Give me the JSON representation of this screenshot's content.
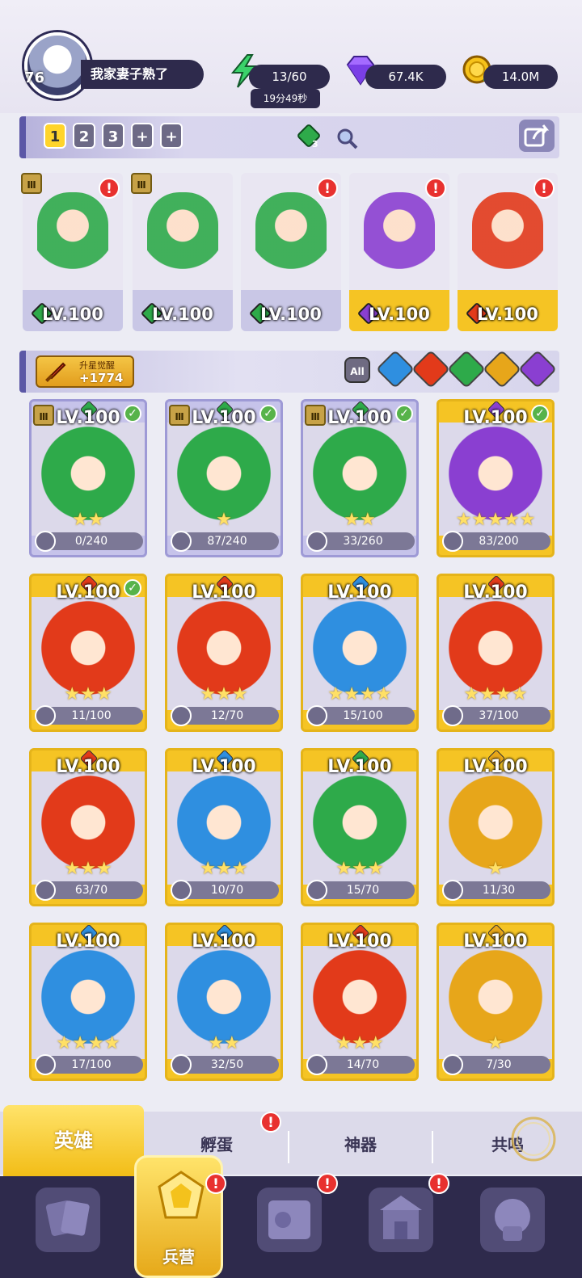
{
  "player": {
    "level": "76",
    "name": "我家妻子熟了"
  },
  "resources": {
    "energy": "13/60",
    "energy_timer": "19分49秒",
    "gems": "67.4K",
    "gold": "14.0M"
  },
  "team": {
    "tabs": [
      "1",
      "2",
      "3",
      "+",
      "+"
    ],
    "active_tab": "1",
    "badge_count": "3",
    "members": [
      {
        "level": "LV.100",
        "element": "nature",
        "color": "#c9c7e6",
        "alert": true,
        "rank": true
      },
      {
        "level": "LV.100",
        "element": "nature",
        "color": "#c9c7e6",
        "alert": false,
        "rank": true
      },
      {
        "level": "LV.100",
        "element": "nature",
        "color": "#c9c7e6",
        "alert": true,
        "rank": false
      },
      {
        "level": "LV.100",
        "element": "dark",
        "color": "#f5c424",
        "alert": true,
        "rank": false
      },
      {
        "level": "LV.100",
        "element": "fire",
        "color": "#f5c424",
        "alert": true,
        "rank": false
      }
    ]
  },
  "upgrade": {
    "label": "升星觉醒",
    "value": "+1774"
  },
  "filters": {
    "all_label": "All",
    "elements": [
      "water",
      "fire",
      "nature",
      "light",
      "dark"
    ]
  },
  "element_colors": {
    "water": "#2f8fe0",
    "fire": "#e23a1a",
    "nature": "#2eaa4a",
    "light": "#e7a61a",
    "dark": "#8a3fd1"
  },
  "heroes": [
    {
      "level": "LV.100",
      "element": "nature",
      "stars": "★★",
      "progress": "0/240",
      "check": true,
      "purple": true,
      "rank": true
    },
    {
      "level": "LV.100",
      "element": "nature",
      "stars": "★",
      "progress": "87/240",
      "check": true,
      "purple": true,
      "rank": true
    },
    {
      "level": "LV.100",
      "element": "nature",
      "stars": "★★",
      "progress": "33/260",
      "check": true,
      "purple": true,
      "rank": true
    },
    {
      "level": "LV.100",
      "element": "dark",
      "stars": "★★★★★",
      "progress": "83/200",
      "check": true,
      "purple": false,
      "rank": false
    },
    {
      "level": "LV.100",
      "element": "fire",
      "stars": "★★★",
      "progress": "11/100",
      "check": true,
      "purple": false,
      "rank": false
    },
    {
      "level": "LV.100",
      "element": "fire",
      "stars": "★★★",
      "progress": "12/70",
      "check": false,
      "purple": false,
      "rank": false
    },
    {
      "level": "LV.100",
      "element": "water",
      "stars": "★★★★",
      "progress": "15/100",
      "check": false,
      "purple": false,
      "rank": false
    },
    {
      "level": "LV.100",
      "element": "fire",
      "stars": "★★★★",
      "progress": "37/100",
      "check": false,
      "purple": false,
      "rank": false
    },
    {
      "level": "LV.100",
      "element": "fire",
      "stars": "★★★",
      "progress": "63/70",
      "check": false,
      "purple": false,
      "rank": false
    },
    {
      "level": "LV.100",
      "element": "water",
      "stars": "★★★",
      "progress": "10/70",
      "check": false,
      "purple": false,
      "rank": false
    },
    {
      "level": "LV.100",
      "element": "nature",
      "stars": "★★★",
      "progress": "15/70",
      "check": false,
      "purple": false,
      "rank": false
    },
    {
      "level": "LV.100",
      "element": "light",
      "stars": "★",
      "progress": "11/30",
      "check": false,
      "purple": false,
      "rank": false
    },
    {
      "level": "LV.100",
      "element": "water",
      "stars": "★★★★",
      "progress": "17/100",
      "check": false,
      "purple": false,
      "rank": false
    },
    {
      "level": "LV.100",
      "element": "water",
      "stars": "★★",
      "progress": "32/50",
      "check": false,
      "purple": false,
      "rank": false
    },
    {
      "level": "LV.100",
      "element": "fire",
      "stars": "★★★",
      "progress": "14/70",
      "check": false,
      "purple": false,
      "rank": false
    },
    {
      "level": "LV.100",
      "element": "light",
      "stars": "★",
      "progress": "7/30",
      "check": false,
      "purple": false,
      "rank": false
    }
  ],
  "subtabs": {
    "heroes": "英雄",
    "eggs": "孵蛋",
    "artifacts": "神器",
    "resonance": "共鸣"
  },
  "nav": {
    "barracks": "兵营"
  }
}
